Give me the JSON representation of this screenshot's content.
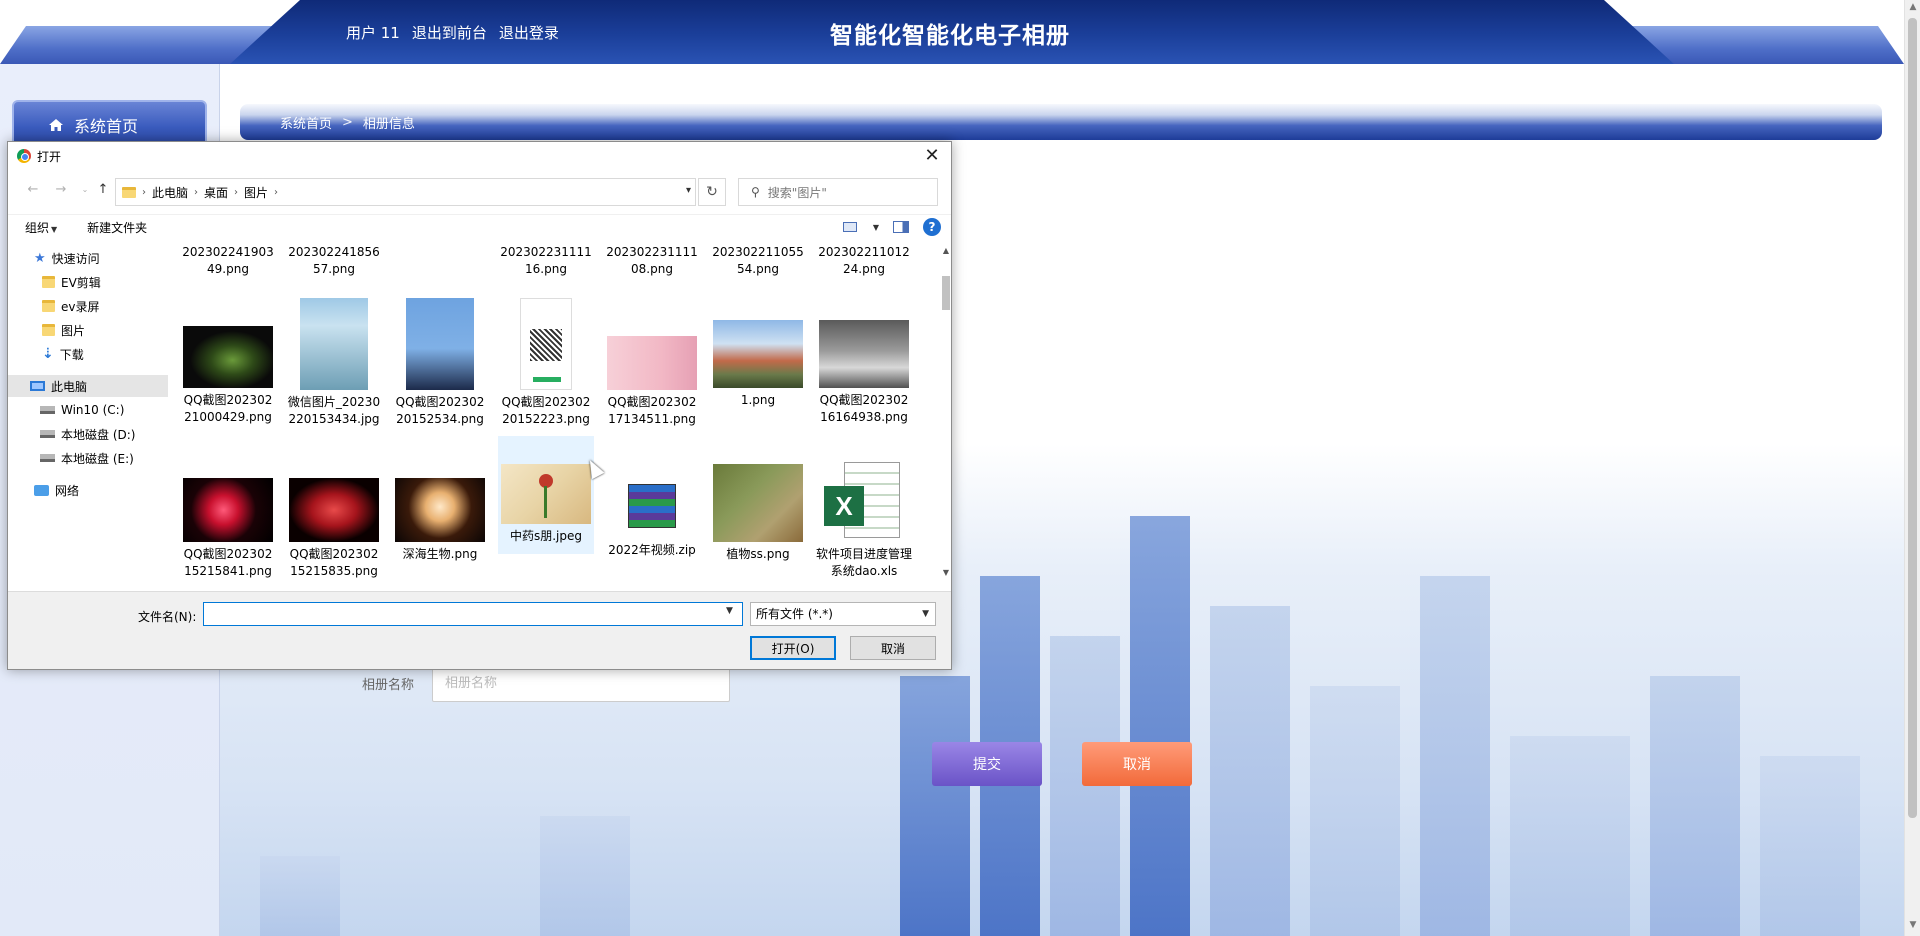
{
  "header": {
    "user_label": "用户 11",
    "front_label": "退出到前台",
    "logout_label": "退出登录",
    "title": "智能化智能化电子相册"
  },
  "sidebar": {
    "home_label": "系统首页"
  },
  "breadcrumb": {
    "home": "系统首页",
    "sep": ">",
    "current": "相册信息"
  },
  "form": {
    "album_name_label": "相册名称",
    "album_name_placeholder": "相册名称",
    "submit_label": "提交",
    "cancel_label": "取消"
  },
  "dialog": {
    "title": "打开",
    "close": "✕",
    "address": [
      "此电脑",
      "桌面",
      "图片"
    ],
    "search_placeholder": "搜索\"图片\"",
    "organize_label": "组织",
    "new_folder_label": "新建文件夹",
    "help": "?",
    "tree": [
      {
        "label": "快速访问",
        "icon": "star-icon"
      },
      {
        "label": "EV剪辑",
        "icon": "folder-icon"
      },
      {
        "label": "ev录屏",
        "icon": "folder-icon"
      },
      {
        "label": "图片",
        "icon": "folder-icon"
      },
      {
        "label": "下载",
        "icon": "download-icon"
      },
      {
        "label": "此电脑",
        "icon": "pc-icon"
      },
      {
        "label": "Win10 (C:)",
        "icon": "drive-icon"
      },
      {
        "label": "本地磁盘 (D:)",
        "icon": "drive-icon"
      },
      {
        "label": "本地磁盘 (E:)",
        "icon": "drive-icon"
      },
      {
        "label": "网络",
        "icon": "network-icon"
      }
    ],
    "files_row0": [
      "20230224190349.png",
      "20230224185657.png",
      "",
      "20230223111116.png",
      "20230223111108.png",
      "20230221105554.png",
      "20230221101224.png"
    ],
    "files_row1": [
      "QQ截图20230221000429.png",
      "微信图片_20230220153434.jpg",
      "QQ截图20230220152534.png",
      "QQ截图20230220152223.png",
      "QQ截图20230217134511.png",
      "1.png",
      "QQ截图20230216164938.png"
    ],
    "files_row2": [
      "QQ截图20230215215841.png",
      "QQ截图20230215215835.png",
      "深海生物.png",
      "中药s朋.jpeg",
      "2022年视频.zip",
      "植物ss.png",
      "软件项目进度管理系统dao.xls"
    ],
    "filename_label": "文件名(N):",
    "filename_value": "",
    "filetype_value": "所有文件 (*.*)",
    "open_label": "打开(O)",
    "cancel_label": "取消"
  },
  "colors": {
    "header_dark": "#0f2a78",
    "header_light": "#2a53b4",
    "submit": "#6a53c7",
    "cancel": "#f26a3a",
    "dialog_accent": "#0078d7"
  }
}
